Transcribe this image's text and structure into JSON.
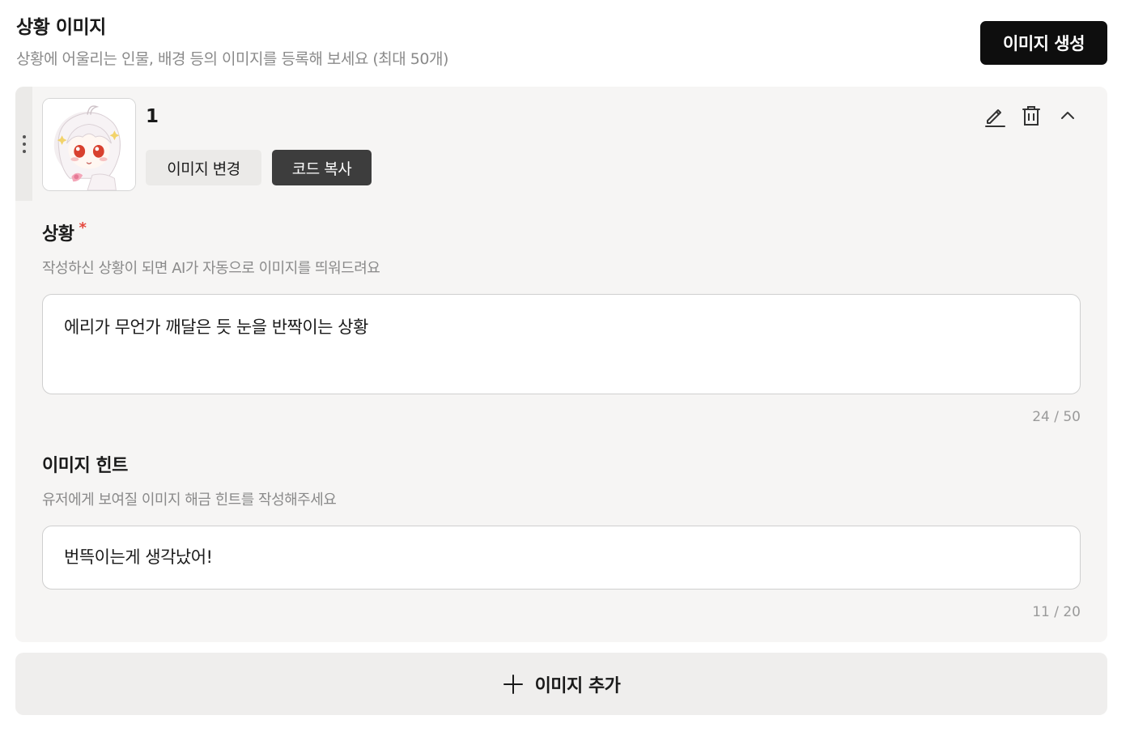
{
  "header": {
    "title": "상황 이미지",
    "description": "상황에 어울리는 인물, 배경 등의 이미지를 등록해 보세요 (최대 50개)",
    "generate_label": "이미지 생성"
  },
  "item": {
    "number": "1",
    "change_image_label": "이미지 변경",
    "copy_code_label": "코드 복사",
    "icons": [
      "drag-handle-icon",
      "pencil-icon",
      "trash-icon",
      "chevron-up-icon"
    ],
    "situation": {
      "label": "상황",
      "required_mark": "*",
      "help": "작성하신 상황이 되면 AI가 자동으로 이미지를 띄워드려요",
      "value": "에리가 무언가 깨달은 듯 눈을 반짝이는 상황",
      "counter": "24 / 50"
    },
    "hint": {
      "label": "이미지 힌트",
      "help": "유저에게 보여질 이미지 해금 힌트를 작성해주세요",
      "value": "번뜩이는게 생각났어!",
      "counter": "11 / 20"
    }
  },
  "footer": {
    "add_label": "이미지 추가"
  },
  "colors": {
    "accent_dark": "#0e0e0e",
    "card_bg": "#f6f5f4",
    "required": "#e5483e"
  }
}
